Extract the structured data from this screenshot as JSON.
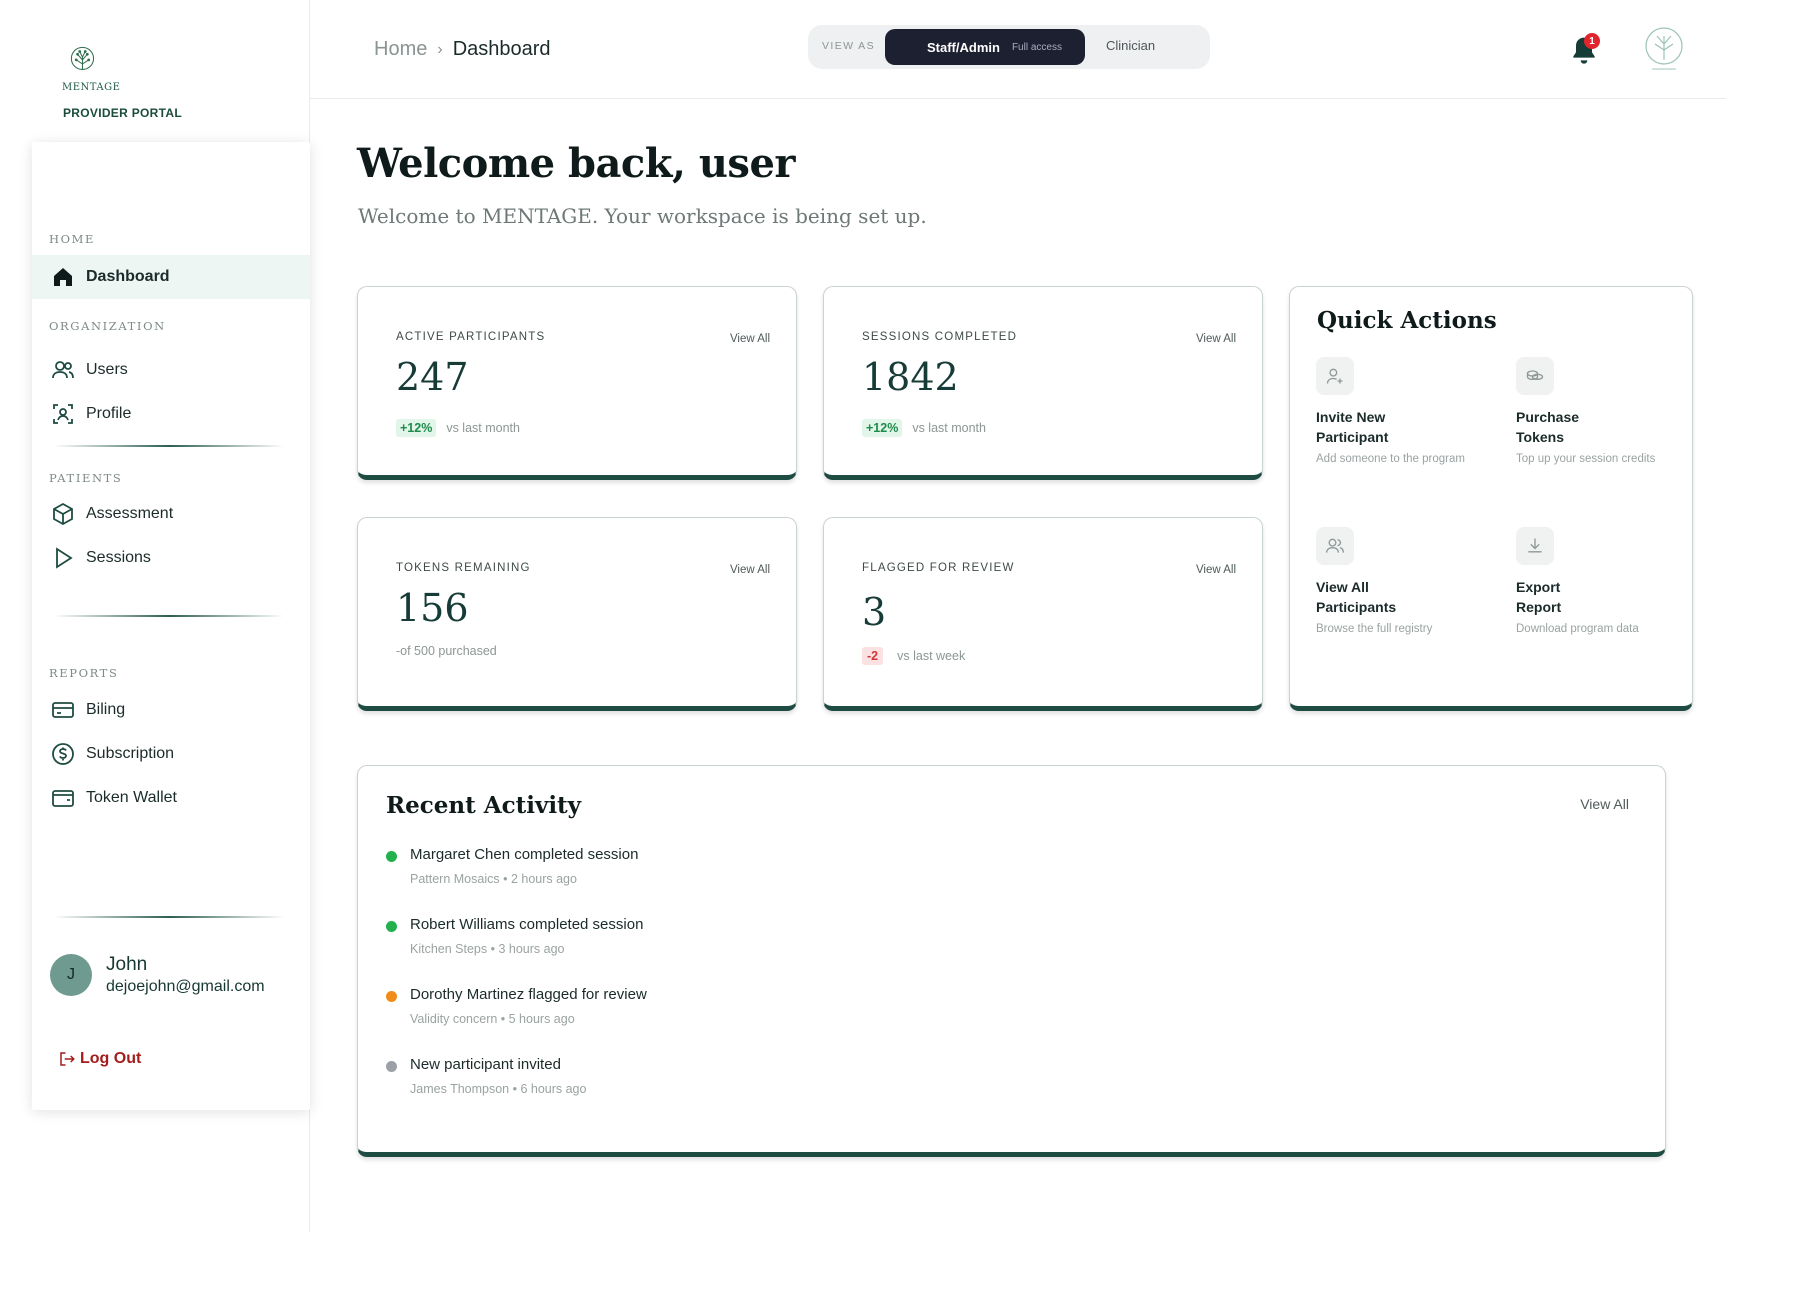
{
  "brand": {
    "name": "MENTAGE",
    "portal": "PROVIDER PORTAL"
  },
  "header": {
    "breadcrumb": {
      "home": "Home",
      "current": "Dashboard"
    },
    "view_as": {
      "label": "VIEW AS",
      "active_role": "Staff/Admin",
      "active_access": "Full access",
      "other_role": "Clinician"
    },
    "notifications_count": "1"
  },
  "sidebar": {
    "sections": {
      "home": "HOME",
      "organization": "ORGANIZATION",
      "patients": "PATIENTS",
      "reports": "REPORTS"
    },
    "items": {
      "dashboard": "Dashboard",
      "users": "Users",
      "profile": "Profile",
      "assessment": "Assessment",
      "sessions": "Sessions",
      "billing": "Biling",
      "subscription": "Subscription",
      "token_wallet": "Token Wallet"
    },
    "user": {
      "initial": "J",
      "name": "John",
      "email": "dejoejohn@gmail.com"
    },
    "logout": "Log Out"
  },
  "main": {
    "welcome_title": "Welcome back, user",
    "welcome_subtitle": "Welcome to MENTAGE. Your workspace is being set up.",
    "stats": {
      "active": {
        "label": "ACTIVE PARTICIPANTS",
        "value": "247",
        "badge": "+12%",
        "note": "vs last month",
        "view": "View All"
      },
      "sessions": {
        "label": "SESSIONS COMPLETED",
        "value": "1842",
        "badge": "+12%",
        "note": "vs last month",
        "view": "View All"
      },
      "tokens": {
        "label": "TOKENS REMAINING",
        "value": "156",
        "note": "-of 500 purchased",
        "view": "View All"
      },
      "flagged": {
        "label": "FLAGGED FOR REVIEW",
        "value": "3",
        "badge": "-2",
        "note": "vs last week",
        "view": "View All"
      }
    },
    "quick_actions": {
      "title": "Quick Actions",
      "invite": {
        "label_1": "Invite New",
        "label_2": "Participant",
        "desc": "Add someone to the program"
      },
      "purchase": {
        "label_1": "Purchase",
        "label_2": "Tokens",
        "desc": "Top up your session credits"
      },
      "view_all": {
        "label_1": "View All",
        "label_2": "Participants",
        "desc": "Browse the full registry"
      },
      "export": {
        "label_1": "Export",
        "label_2": "Report",
        "desc": "Download program data"
      }
    },
    "recent_activity": {
      "title": "Recent Activity",
      "view": "View All",
      "items": [
        {
          "text": "Margaret Chen completed session",
          "meta": "Pattern Mosaics • 2 hours ago",
          "color": "#22b14c"
        },
        {
          "text": "Robert Williams completed session",
          "meta": "Kitchen Steps • 3 hours ago",
          "color": "#22b14c"
        },
        {
          "text": "Dorothy Martinez flagged for review",
          "meta": "Validity concern • 5 hours ago",
          "color": "#f28c18"
        },
        {
          "text": "New participant invited",
          "meta": "James Thompson • 6 hours ago",
          "color": "#9aa0a6"
        }
      ]
    }
  },
  "colors": {
    "brand_dark": "#1f4c42",
    "accent_green": "#22b14c",
    "alert_red": "#e0252f",
    "logout_red": "#a31d1d"
  }
}
